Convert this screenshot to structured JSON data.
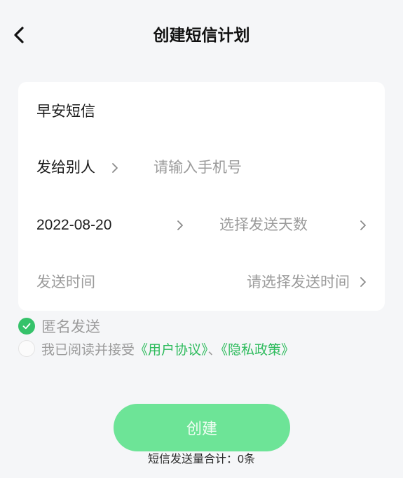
{
  "header": {
    "title": "创建短信计划",
    "back_icon": "chevron-left-icon"
  },
  "form": {
    "name_value": "早安短信",
    "recipient_label": "发给别人",
    "phone_placeholder": "请输入手机号",
    "start_date": "2022-08-20",
    "days_placeholder": "选择发送天数",
    "time_label": "发送时间",
    "time_placeholder": "请选择发送时间",
    "chevron_icon": "chevron-right-icon"
  },
  "options": {
    "anonymous_label": "匿名发送",
    "anonymous_checked": true,
    "agreement_prefix": "我已阅读并接受",
    "user_agreement": "《用户协议》",
    "separator": "、",
    "privacy_policy": "《隐私政策》",
    "agreement_checked": false
  },
  "actions": {
    "create_label": "创建"
  },
  "footer": {
    "summary": "短信发送量合计：0条"
  },
  "colors": {
    "background": "#f5f6f8",
    "accent_green": "#35c26a",
    "button_green": "#6de497",
    "link_green": "#2dbb5c",
    "placeholder_gray": "#9b9b9b"
  }
}
